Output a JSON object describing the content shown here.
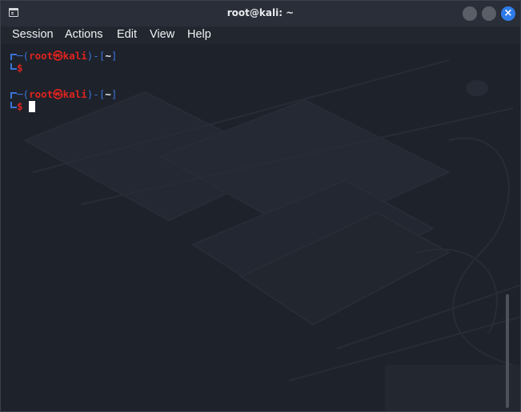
{
  "window": {
    "title": "root@kali: ~",
    "close_glyph": "×",
    "icons": [
      "terminal-icon",
      "minimize-icon",
      "maximize-icon",
      "close-icon"
    ]
  },
  "menu": {
    "session": "Session",
    "actions": "Actions",
    "edit": "Edit",
    "view": "View",
    "help": "Help"
  },
  "terminal": {
    "prompts": [
      {
        "dash_left": "─(",
        "user_host": "root㉿kali",
        "dash_mid": ")-[",
        "dir": "~",
        "dash_right": "]",
        "symbol": "$"
      },
      {
        "dash_left": "─(",
        "user_host": "root㉿kali",
        "dash_mid": ")-[",
        "dir": "~",
        "dash_right": "]",
        "symbol": "$"
      }
    ]
  },
  "colors": {
    "prompt_blue": "#3b74d8",
    "prompt_red": "#e0231f",
    "close_button": "#2f7bea",
    "background": "#1e222b"
  }
}
